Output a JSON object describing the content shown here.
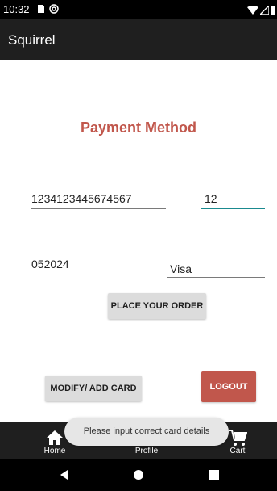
{
  "status_bar": {
    "time": "10:32",
    "icons": [
      "sim-card-icon",
      "at-sign-icon",
      "wifi-icon",
      "signal-icon",
      "battery-icon"
    ]
  },
  "app_bar": {
    "title": "Squirrel"
  },
  "page": {
    "title": "Payment Method",
    "card_number_value": "1234123445674567",
    "cvv_value": "12",
    "expiry_value": "052024",
    "card_type_value": "Visa",
    "place_order_label": "PLACE YOUR ORDER",
    "modify_card_label": "MODIFY/ ADD CARD",
    "logout_label": "LOGOUT"
  },
  "bottom_nav": {
    "items": [
      {
        "label": "Home",
        "icon": "home-icon"
      },
      {
        "label": "Profile",
        "icon": "person-icon"
      },
      {
        "label": "Cart",
        "icon": "cart-icon"
      }
    ]
  },
  "toast": {
    "message": "Please input correct card details"
  },
  "system_nav": {
    "icons": [
      "back-icon",
      "home-circle-icon",
      "recents-icon"
    ]
  },
  "colors": {
    "accent_red": "#c1574c",
    "focus_teal": "#1a8a8f",
    "bar_dark": "#1f1f1f",
    "button_grey": "#dcdcdc"
  }
}
